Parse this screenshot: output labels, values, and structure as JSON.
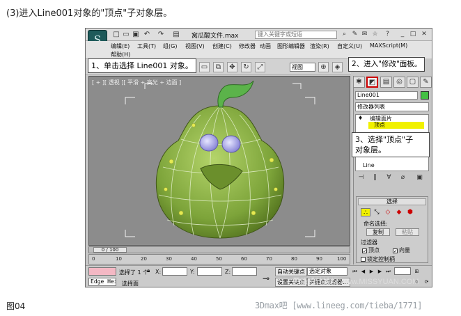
{
  "caption_top": "(3)进入Line001对象的\"顶点\"子对象层。",
  "caption_bottom": "图04",
  "footer_url": "3Dmax吧 [www.lineeg.com/tieba/1771]",
  "watermark": "思缘设计论坛 www.MISSYUAN.COM",
  "app": {
    "logo": "S",
    "doc_title": "窝瓜酸文件.max",
    "search_placeholder": "键入关键字或短语",
    "help_icon": "?"
  },
  "menu": [
    "编辑(E)",
    "工具(T)",
    "组(G)",
    "视图(V)",
    "创建(C)",
    "修改器",
    "动画",
    "图形编辑器",
    "渲染(R)",
    "自定义(U)",
    "MAXScript(M)"
  ],
  "menu_second_row": "帮助(H)",
  "toolbar": {
    "view_dropdown": "视图"
  },
  "viewport": {
    "label": "[ + ][ 透视 ][ 平滑 + 高光 + 边面 ]"
  },
  "timeline": {
    "thumb": "0 / 100",
    "ticks": [
      "0",
      "10",
      "20",
      "30",
      "40",
      "50",
      "60",
      "70",
      "80",
      "90",
      "100"
    ]
  },
  "status": {
    "selected_count": "选择了 1 个",
    "x_label": "X:",
    "y_label": "Y:",
    "z_label": "Z:",
    "auto_key": "自动关键点",
    "selected_object": "选定对象",
    "set_key": "设置关键点",
    "key_filters": "关键点过滤器...",
    "prompt": "选择面",
    "edge_label": "Edge Heig"
  },
  "panel": {
    "object_name": "Line001",
    "modifier_list": "修改器列表",
    "stack_items": [
      "编辑面片",
      "顶点",
      "Line"
    ],
    "selection_header": "选择",
    "named_selection": "命名选择:",
    "copy_button": "复制",
    "paste_button": "粘贴",
    "filter_label": "过滤器",
    "vertex_check": "顶点",
    "vector_check": "向量",
    "lock_handles": "锁定控制柄",
    "swatch_color": "#43c043"
  },
  "callouts": {
    "one": "1、单击选择 Line001 对象。",
    "two": "2、进入\"修改\"面板。",
    "three_line1": "3、选择\"顶点\"子",
    "three_line2": "对象层。"
  }
}
